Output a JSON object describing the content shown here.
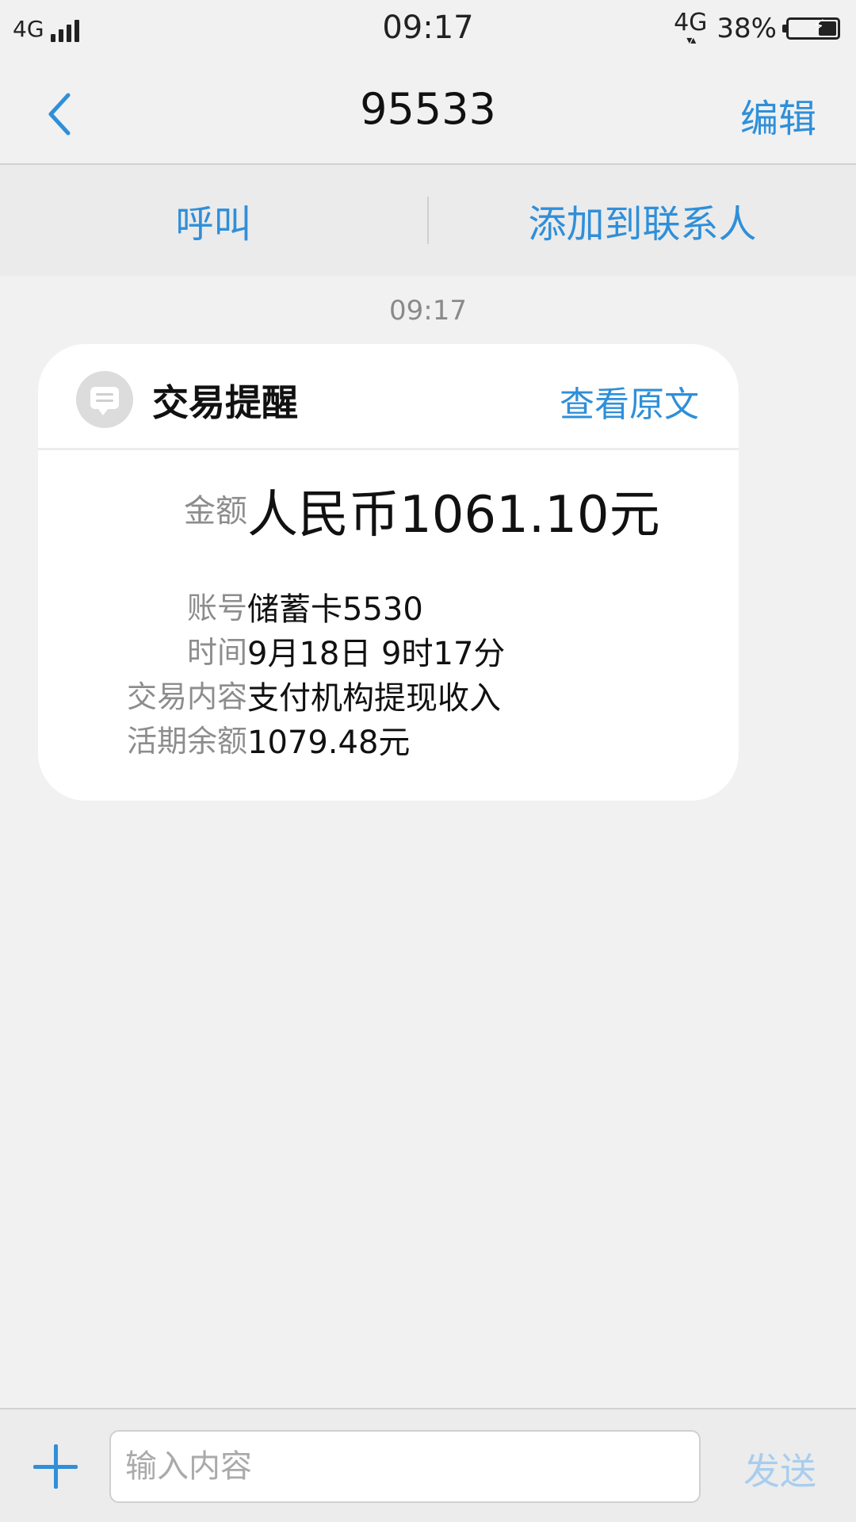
{
  "status_bar": {
    "network": "4G",
    "time": "09:17",
    "data_network": "4G",
    "data_arrows": "▾▴",
    "battery_percent": "38%",
    "battery_level": 0.38
  },
  "nav": {
    "title": "95533",
    "edit_label": "编辑"
  },
  "actions": {
    "call_label": "呼叫",
    "add_contact_label": "添加到联系人"
  },
  "thread": {
    "timestamp": "09:17",
    "card": {
      "title": "交易提醒",
      "view_original_label": "查看原文",
      "rows": [
        {
          "label": "金额",
          "value": "人民币1061.10元"
        },
        {
          "label": "账号",
          "value": "储蓄卡5530"
        },
        {
          "label": "时间",
          "value": "9月18日 9时17分"
        },
        {
          "label": "交易内容",
          "value": "支付机构提现收入"
        },
        {
          "label": "活期余额",
          "value": "1079.48元"
        }
      ]
    }
  },
  "composer": {
    "placeholder": "输入内容",
    "send_label": "发送"
  },
  "colors": {
    "accent": "#2f8fd9",
    "send_disabled": "#a8cdee",
    "background": "#f1f1f1",
    "label_gray": "#8d8d8d"
  },
  "icons": {
    "back": "chevron-left-icon",
    "message": "message-bubble-icon",
    "plus": "plus-icon",
    "signal": "signal-bars-icon",
    "battery": "battery-charging-icon"
  }
}
